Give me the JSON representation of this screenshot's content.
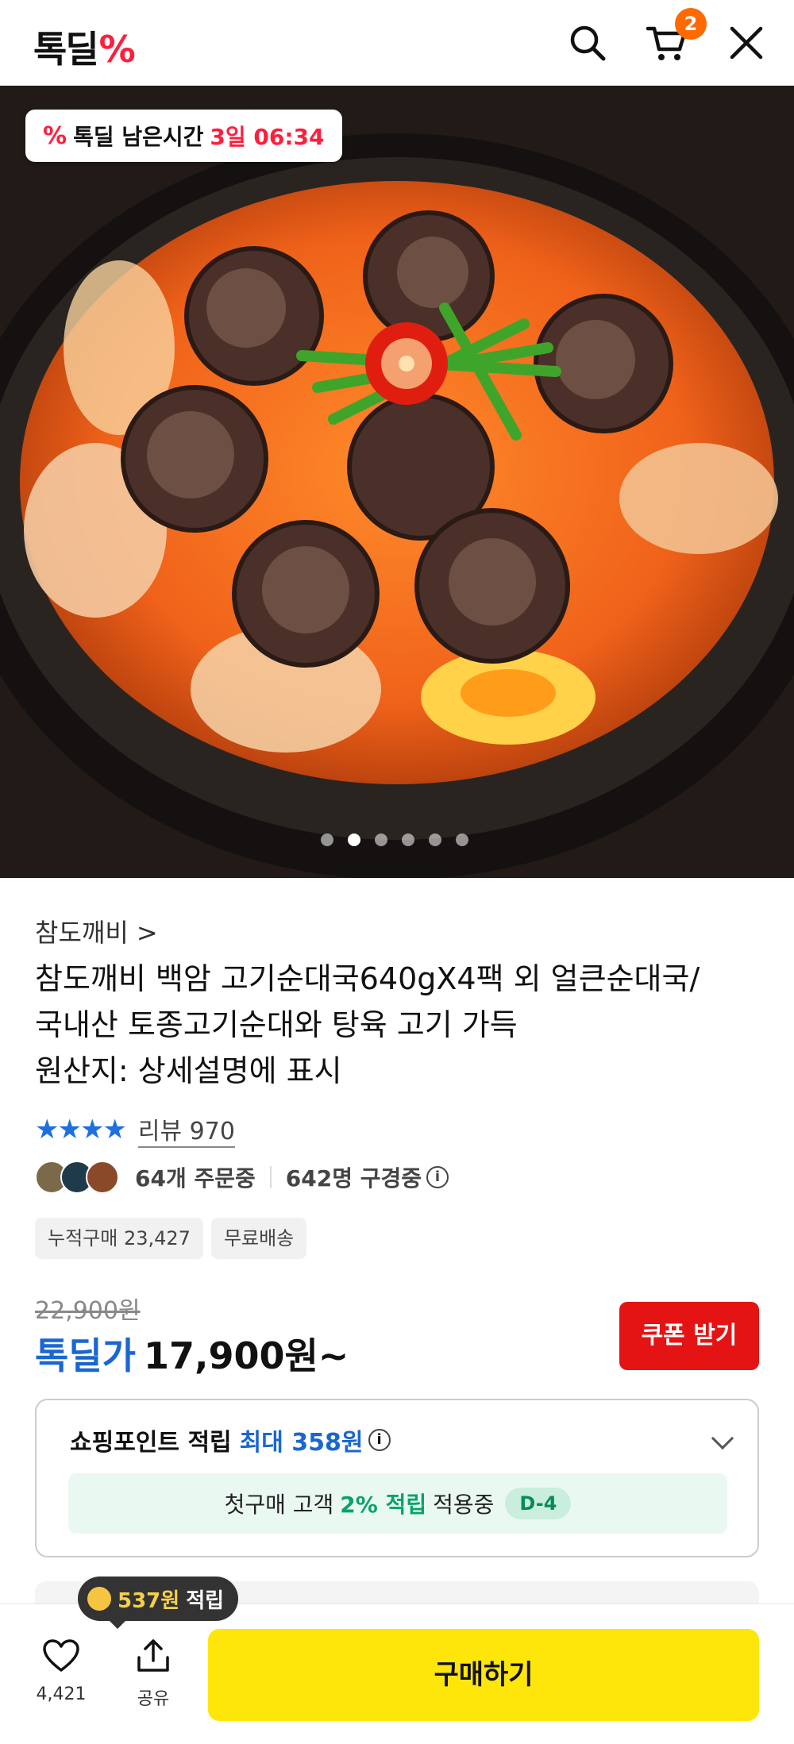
{
  "header": {
    "logo_text": "톡딜",
    "logo_mark": "%",
    "cart_count": "2",
    "icons": [
      "search-icon",
      "cart-icon",
      "close-icon"
    ]
  },
  "hero": {
    "timer_mark": "%",
    "timer_label": "톡딜 남은시간",
    "timer_value": "3일 06:34",
    "dot_count": 6,
    "active_dot": 1
  },
  "product": {
    "brand": "참도깨비 >",
    "title_line1": "참도깨비 백암 고기순대국640gX4팩 외 얼큰순대국/",
    "title_line2": "국내산 토종고기순대와 탕육 고기 가득",
    "title_line3": "원산지: 상세설명에 표시",
    "stars": "★★★★",
    "review_text": "리뷰 970",
    "orders_text": "64개 주문중",
    "viewers_text": "642명 구경중",
    "info_icon": "i",
    "tags": [
      "누적구매 23,427",
      "무료배송"
    ]
  },
  "price": {
    "original": "22,900원",
    "deal_label": "톡딜가",
    "deal_value": "17,900원~",
    "coupon_button": "쿠폰 받기"
  },
  "points": {
    "head_label": "쇼핑포인트 적립",
    "head_max": "최대 358원",
    "inner_prefix": "첫구매 고객",
    "inner_highlight": "2% 적립",
    "inner_suffix": "적용중",
    "d_badge": "D-4"
  },
  "bottom": {
    "tooltip_amount": "537원",
    "tooltip_label": "적립",
    "like_count": "4,421",
    "share_label": "공유",
    "buy_button": "구매하기"
  },
  "colors": {
    "brand_red": "#ff1e3c",
    "deal_blue": "#1a66d2",
    "coupon_red": "#e51414",
    "buy_yellow": "#ffe60a",
    "point_green": "#0aa36b"
  }
}
